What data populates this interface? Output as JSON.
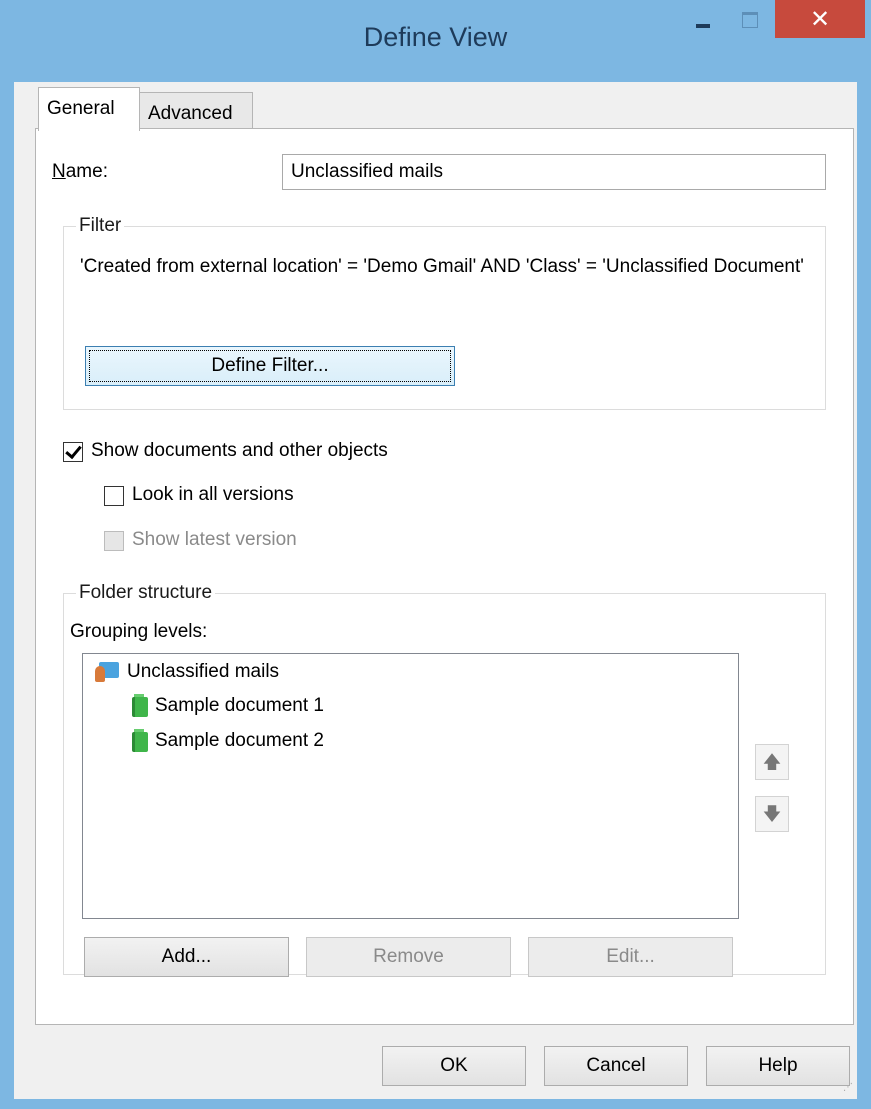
{
  "window": {
    "title": "Define View",
    "close_glyph": "✕",
    "colors": {
      "frame": "#7db7e2",
      "close": "#c74a3d",
      "client": "#f0f0f0"
    }
  },
  "tabs": [
    {
      "label": "General",
      "selected": true
    },
    {
      "label": "Advanced",
      "selected": false
    }
  ],
  "general": {
    "name_label": "Name:",
    "name_value": "Unclassified mails",
    "filter": {
      "legend": "Filter",
      "text": "'Created from external location' = 'Demo Gmail' AND 'Class' = 'Unclassified Document'",
      "define_button": "Define Filter..."
    },
    "show_documents": {
      "label": "Show documents and other objects",
      "checked": true
    },
    "look_in_all_versions": {
      "label": "Look in all versions",
      "checked": false
    },
    "show_latest_version": {
      "label": "Show latest version",
      "checked": false,
      "disabled": true
    },
    "folder_structure": {
      "legend": "Folder structure",
      "grouping_label": "Grouping levels:",
      "tree": [
        {
          "label": "Unclassified mails",
          "icon": "view-folder-icon",
          "level": 0
        },
        {
          "label": "Sample document 1",
          "icon": "document-icon",
          "level": 1
        },
        {
          "label": "Sample document 2",
          "icon": "document-icon",
          "level": 1
        }
      ],
      "move_up_glyph": "🡅",
      "move_down_glyph": "🡇",
      "add_button": "Add...",
      "remove_button": "Remove",
      "edit_button": "Edit..."
    }
  },
  "footer": {
    "ok": "OK",
    "cancel": "Cancel",
    "help": "Help"
  }
}
